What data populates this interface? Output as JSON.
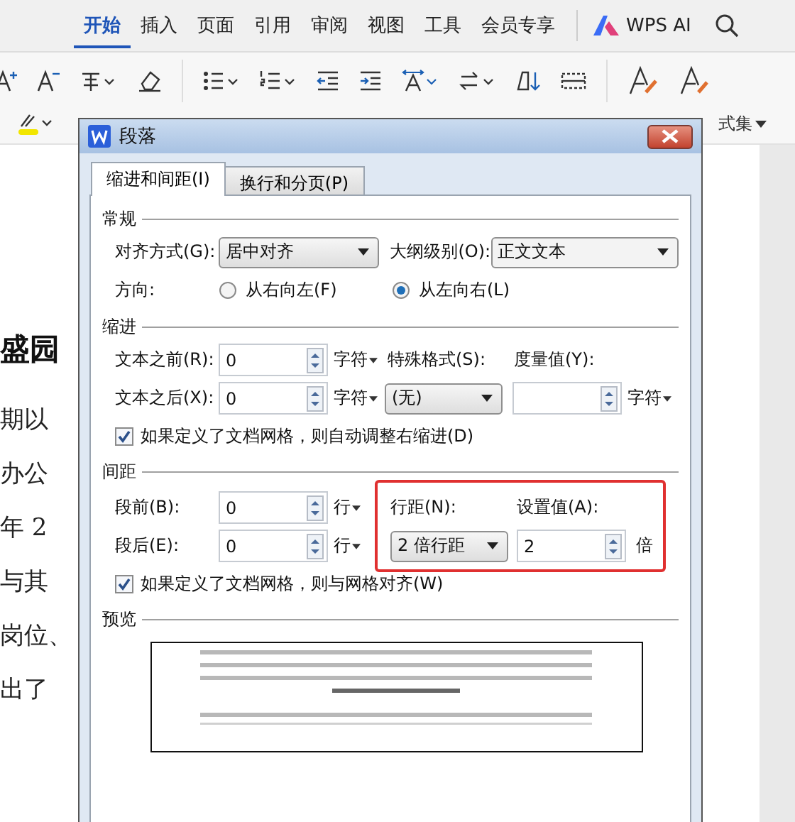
{
  "menu_tabs": [
    {
      "label": "开始",
      "selected": true
    },
    {
      "label": "插入",
      "selected": false
    },
    {
      "label": "页面",
      "selected": false
    },
    {
      "label": "引用",
      "selected": false
    },
    {
      "label": "审阅",
      "selected": false
    },
    {
      "label": "视图",
      "selected": false
    },
    {
      "label": "工具",
      "selected": false
    },
    {
      "label": "会员专享",
      "selected": false
    }
  ],
  "ai_button": "WPS AI",
  "ribbon_label": "式集",
  "document_lines": [
    {
      "kind": "heading",
      "text": "盛园"
    },
    {
      "kind": "body",
      "text": "期以"
    },
    {
      "kind": "body",
      "text": "办公"
    },
    {
      "kind": "body",
      "text": "年 2"
    },
    {
      "kind": "body",
      "text": "与其"
    },
    {
      "kind": "body",
      "text": "岗位、"
    },
    {
      "kind": "body",
      "text": "出了"
    }
  ],
  "dialog": {
    "title": "段落",
    "tabs": [
      {
        "label": "缩进和间距(I)",
        "selected": true
      },
      {
        "label": "换行和分页(P)",
        "selected": false
      }
    ],
    "general": {
      "heading": "常规",
      "alignment": {
        "label": "对齐方式(G):",
        "value": "居中对齐"
      },
      "outline": {
        "label": "大纲级别(O):",
        "value": "正文文本"
      },
      "direction": {
        "label": "方向:",
        "options": [
          {
            "label": "从右向左(F)",
            "selected": false
          },
          {
            "label": "从左向右(L)",
            "selected": true
          }
        ]
      }
    },
    "indent": {
      "heading": "缩进",
      "before": {
        "label": "文本之前(R):",
        "value": "0",
        "unit": "字符"
      },
      "after": {
        "label": "文本之后(X):",
        "value": "0",
        "unit": "字符"
      },
      "special": {
        "label": "特殊格式(S):",
        "value": "(无)"
      },
      "measure": {
        "label": "度量值(Y):",
        "unit": "字符"
      },
      "auto_adjust": {
        "label": "如果定义了文档网格，则自动调整右缩进(D)",
        "checked": true
      }
    },
    "spacing": {
      "heading": "间距",
      "before": {
        "label": "段前(B):",
        "value": "0",
        "unit": "行"
      },
      "after": {
        "label": "段后(E):",
        "value": "0",
        "unit": "行"
      },
      "line": {
        "label": "行距(N):",
        "value": "2 倍行距"
      },
      "set_value": {
        "label": "设置值(A):",
        "value": "2",
        "unit": "倍"
      },
      "highlighted": true,
      "snap_grid": {
        "label": "如果定义了文档网格，则与网格对齐(W)",
        "checked": true
      }
    },
    "preview": {
      "heading": "预览"
    }
  }
}
